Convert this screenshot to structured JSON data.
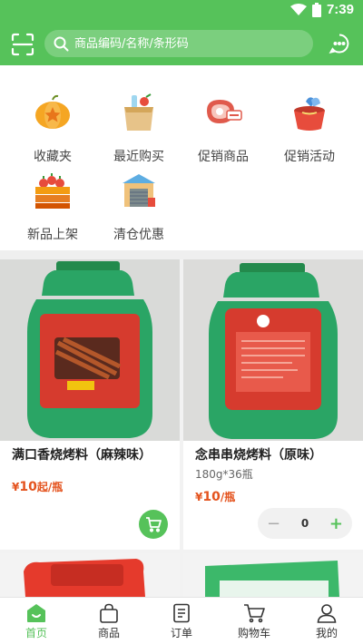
{
  "status_bar": {
    "time": "7:39"
  },
  "search": {
    "placeholder": "商品编码/名称/条形码"
  },
  "categories": [
    {
      "label": "收藏夹",
      "icon": "favorites-icon"
    },
    {
      "label": "最近购买",
      "icon": "recent-purchase-icon"
    },
    {
      "label": "促销商品",
      "icon": "promo-goods-icon"
    },
    {
      "label": "促销活动",
      "icon": "promo-activity-icon"
    },
    {
      "label": "新品上架",
      "icon": "new-arrivals-icon"
    },
    {
      "label": "清仓优惠",
      "icon": "clearance-icon"
    }
  ],
  "products": [
    {
      "name": "满口香烧烤料（麻辣味）",
      "price_symbol": "¥",
      "price_value": "10",
      "price_suffix": "起/瓶"
    },
    {
      "name": "念串串烧烤料（原味）",
      "spec": "180g*36瓶",
      "price_symbol": "¥",
      "price_value": "10",
      "price_suffix": "/瓶",
      "quantity": "0"
    }
  ],
  "tabs": [
    {
      "label": "首页",
      "icon": "home-icon",
      "active": true
    },
    {
      "label": "商品",
      "icon": "bag-icon"
    },
    {
      "label": "订单",
      "icon": "order-icon"
    },
    {
      "label": "购物车",
      "icon": "cart-icon"
    },
    {
      "label": "我的",
      "icon": "user-icon"
    }
  ],
  "colors": {
    "brand_green": "#56c25a",
    "price_orange": "#e4531e"
  }
}
